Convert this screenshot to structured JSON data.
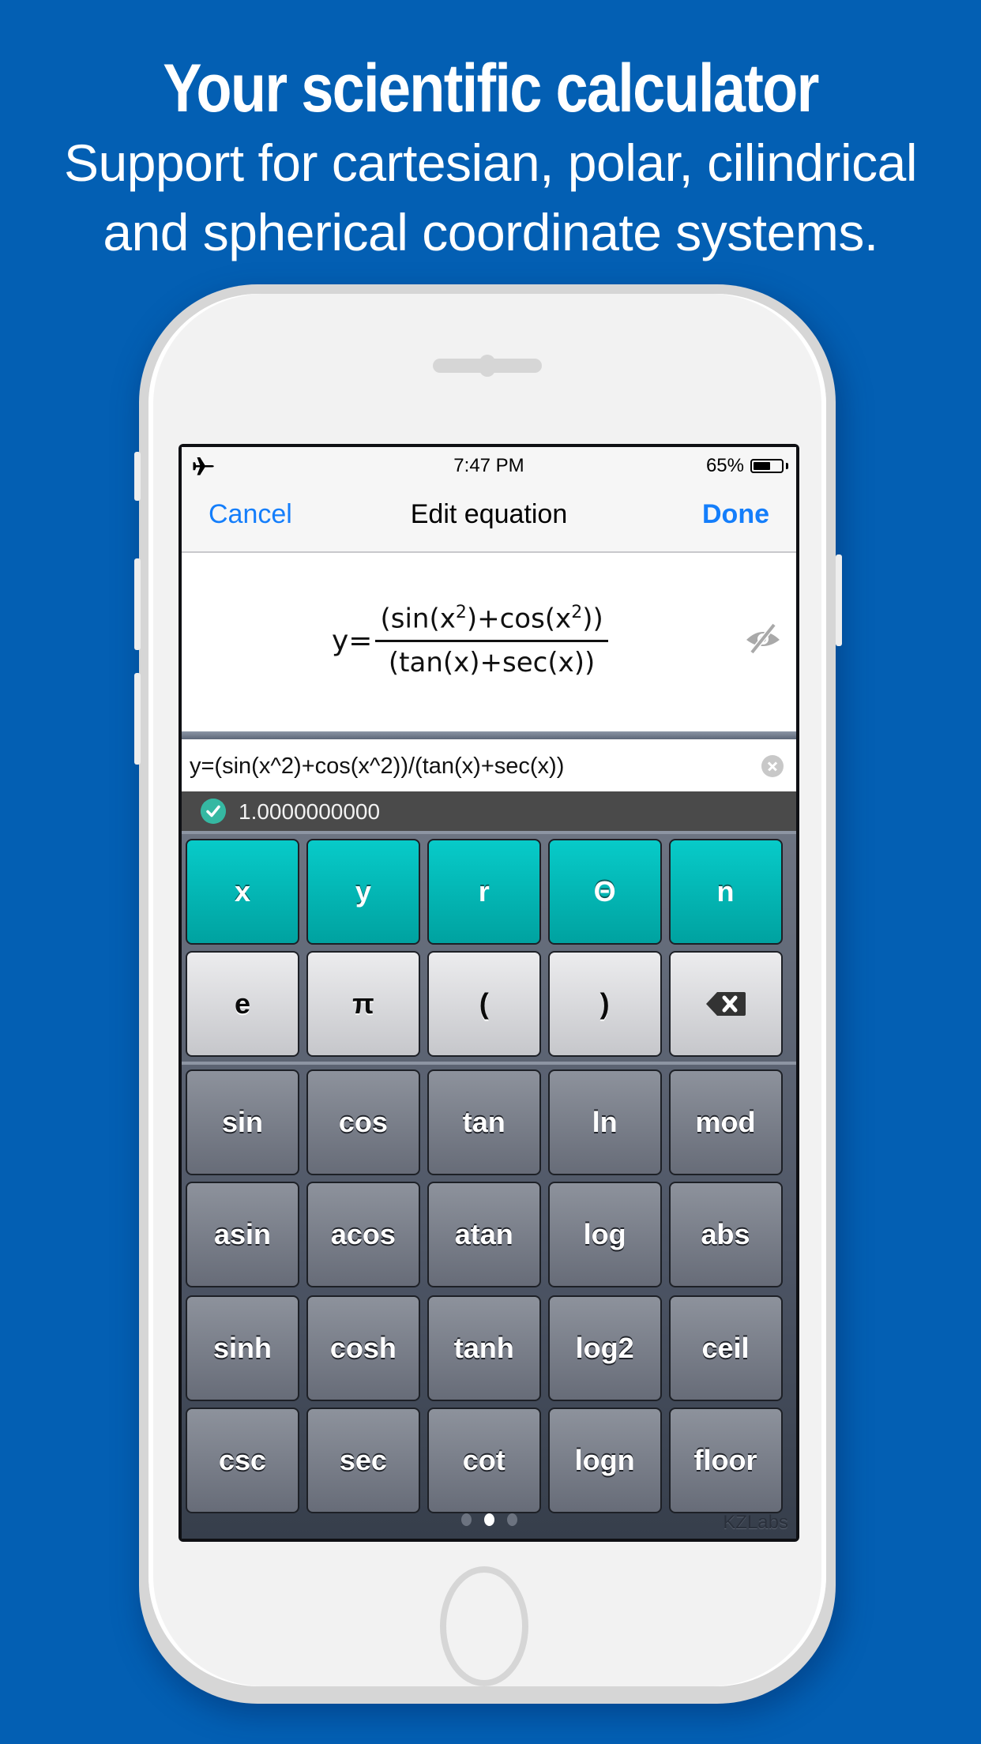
{
  "promo": {
    "headline": "Your scientific calculator",
    "subline_1": "Support for cartesian, polar, cilindrical",
    "subline_2": "and spherical coordinate systems.",
    "background_color": "#035fb3"
  },
  "status_bar": {
    "mode_icon": "airplane-icon",
    "time": "7:47 PM",
    "battery_percent_text": "65%",
    "battery_level": 0.65
  },
  "nav": {
    "cancel_label": "Cancel",
    "title": "Edit equation",
    "done_label": "Done",
    "accent_color": "#147efb"
  },
  "display": {
    "lhs": "y=",
    "numerator": {
      "parts": [
        "(sin(x",
        "2",
        ")+cos(x",
        "2",
        "))"
      ]
    },
    "denominator": "(tan(x)+sec(x))",
    "visibility_icon": "eye-slash-icon"
  },
  "input": {
    "value": "y=(sin(x^2)+cos(x^2))/(tan(x)+sec(x))",
    "clear_icon": "clear-icon"
  },
  "result": {
    "status_icon": "check-icon",
    "value": "1.0000000000",
    "status_color": "#35b8a2"
  },
  "keypad": {
    "rows": [
      {
        "style": "teal",
        "keys": [
          "x",
          "y",
          "r",
          "Θ",
          "n"
        ]
      },
      {
        "style": "light",
        "keys": [
          "e",
          "π",
          "(",
          ")",
          "⌫"
        ]
      },
      {
        "style": "gray",
        "keys": [
          "sin",
          "cos",
          "tan",
          "ln",
          "mod"
        ]
      },
      {
        "style": "gray",
        "keys": [
          "asin",
          "acos",
          "atan",
          "log",
          "abs"
        ]
      },
      {
        "style": "gray",
        "keys": [
          "sinh",
          "cosh",
          "tanh",
          "log2",
          "ceil"
        ]
      },
      {
        "style": "gray",
        "keys": [
          "csc",
          "sec",
          "cot",
          "logn",
          "floor"
        ]
      }
    ],
    "page_count": 3,
    "active_page": 2,
    "brand": "KZLabs"
  }
}
